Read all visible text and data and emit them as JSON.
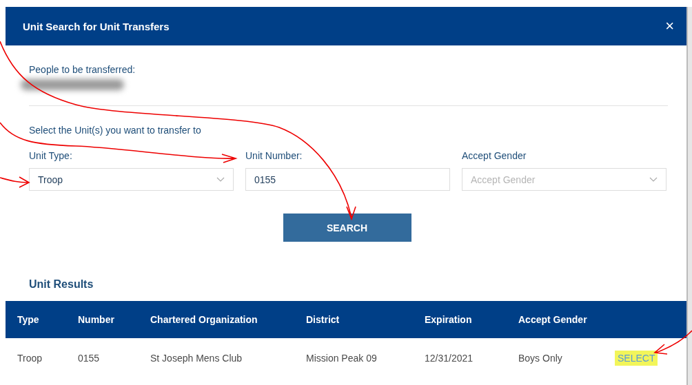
{
  "dialog": {
    "title": "Unit Search for Unit Transfers",
    "close": "×"
  },
  "people": {
    "label": "People to be transferred:",
    "redacted": true
  },
  "instruction": "Select the Unit(s) you want to transfer to",
  "fields": [
    {
      "kind": "select",
      "label": "Unit Type:",
      "value": "Troop"
    },
    {
      "kind": "text",
      "label": "Unit Number:",
      "value": "0155"
    },
    {
      "kind": "select",
      "label": "Accept Gender",
      "placeholder": "Accept Gender"
    }
  ],
  "search_button": "SEARCH",
  "results": {
    "title": "Unit Results",
    "columns": [
      "Type",
      "Number",
      "Chartered Organization",
      "District",
      "Expiration",
      "Accept Gender"
    ],
    "rows": [
      {
        "cells": [
          "Troop",
          "0155",
          "St Joseph Mens Club",
          "Mission Peak 09",
          "12/31/2021",
          "Boys Only"
        ],
        "action": "SELECT",
        "highlighted": true
      }
    ]
  },
  "annotations": [
    {
      "kind": "arrow"
    },
    {
      "kind": "arrow"
    },
    {
      "kind": "arrow"
    },
    {
      "kind": "arrow"
    }
  ]
}
